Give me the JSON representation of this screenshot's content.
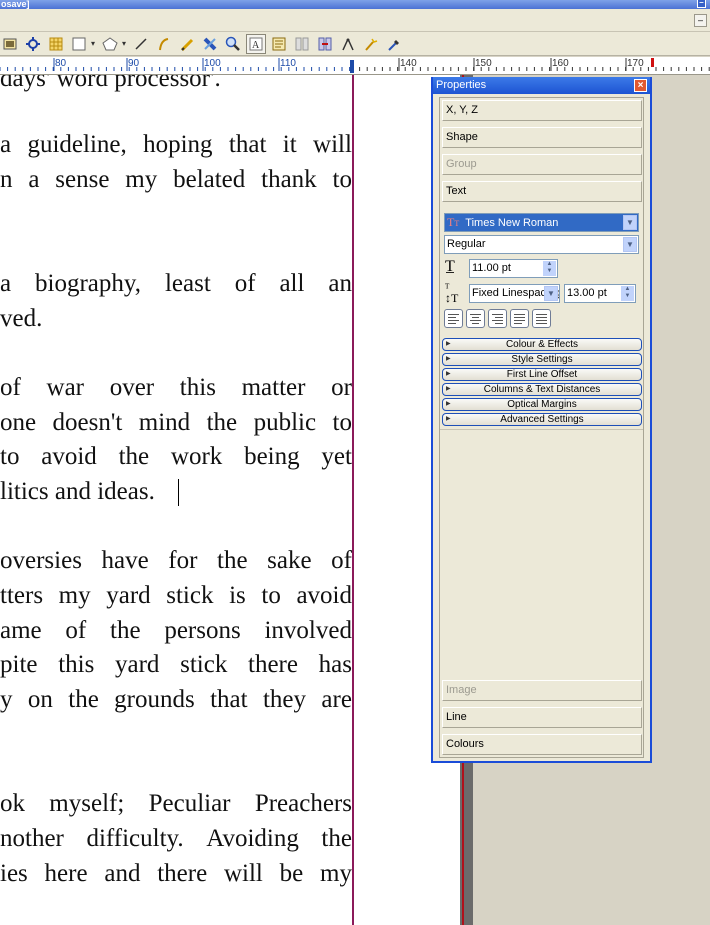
{
  "window": {
    "title_fragment": "osave]"
  },
  "toolbar": {
    "icons": [
      "image-frame-icon",
      "render-frame-icon",
      "table-icon",
      "shape-icon",
      "polygon-icon",
      "line-icon",
      "bezier-icon",
      "freehand-icon",
      "rotate-icon",
      "zoom-icon",
      "edit-contents-icon",
      "edit-text-icon",
      "link-frames-icon",
      "unlink-frames-icon",
      "measure-icon",
      "copy-properties-icon",
      "eyedropper-icon"
    ]
  },
  "ruler": {
    "labels": [
      "80",
      "90",
      "100",
      "110",
      "140",
      "150",
      "160",
      "170"
    ]
  },
  "document": {
    "lines": [
      "days' word processor'.",
      "a guideline, hoping that it will",
      "n a sense my belated thank to",
      "",
      "a biography, least of all an",
      "ved.",
      "",
      "of war over this matter or",
      "one doesn't mind the public to",
      "to avoid the work being yet",
      "litics and ideas.",
      "",
      "oversies have for the sake of",
      "tters my yard stick is to avoid",
      "ame of the persons involved",
      "pite this yard stick there has",
      "y on the grounds that they are",
      "",
      "",
      "ok myself; Peculiar Preachers",
      "nother difficulty. Avoiding the",
      "ies here and there will be my"
    ]
  },
  "properties": {
    "title": "Properties",
    "sections_top": [
      {
        "label": "X, Y, Z",
        "enabled": true
      },
      {
        "label": "Shape",
        "enabled": true
      },
      {
        "label": "Group",
        "enabled": false
      },
      {
        "label": "Text",
        "enabled": true
      }
    ],
    "font_family": "Times New Roman",
    "font_style": "Regular",
    "font_size": "11.00 pt",
    "line_spacing_mode": "Fixed Linespacing",
    "line_spacing": "13.00 pt",
    "alignments": [
      "align-left",
      "align-center",
      "align-right",
      "align-justify",
      "align-forced"
    ],
    "subsections": [
      "Colour & Effects",
      "Style Settings",
      "First Line Offset",
      "Columns & Text Distances",
      "Optical Margins",
      "Advanced Settings"
    ],
    "sections_bottom": [
      {
        "label": "Image",
        "enabled": false
      },
      {
        "label": "Line",
        "enabled": true
      },
      {
        "label": "Colours",
        "enabled": true
      }
    ]
  },
  "colors": {
    "titlebar": "#4c72d4",
    "panel_border": "#1a4cd8",
    "margin_guide": "#8b1a5a",
    "page_bg": "#ffffff"
  }
}
